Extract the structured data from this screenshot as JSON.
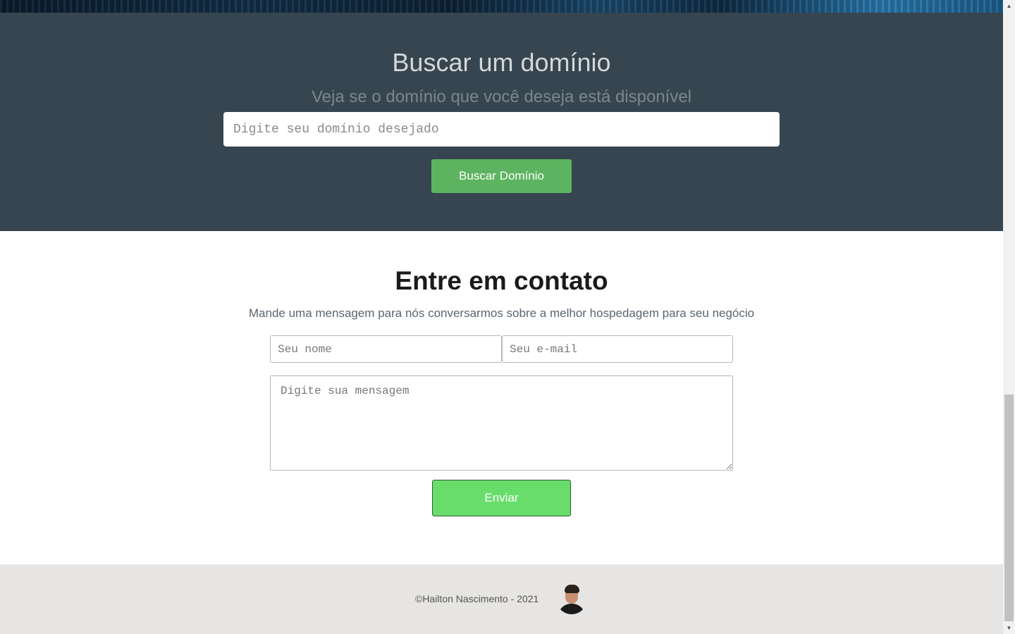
{
  "domain_search": {
    "title": "Buscar um domínio",
    "subtitle": "Veja se o domínio que você deseja está disponível",
    "input_placeholder": "Digite seu domínio desejado",
    "input_value": "",
    "button_label": "Buscar Domínio",
    "background_color": "#36454f",
    "button_color": "#5cb460"
  },
  "contact": {
    "title": "Entre em contato",
    "subtitle": "Mande uma mensagem para nós conversarmos sobre a melhor hospedagem para seu negócio",
    "name_placeholder": "Seu nome",
    "email_placeholder": "Seu e-mail",
    "message_placeholder": "Digite sua mensagem",
    "send_label": "Enviar",
    "send_button_color": "#68dd6c"
  },
  "footer": {
    "copyright": "©Hailton Nascimento - 2021",
    "background_color": "#e6e5e3"
  },
  "icons": {
    "scroll_up": "▲",
    "scroll_down": "▼"
  }
}
